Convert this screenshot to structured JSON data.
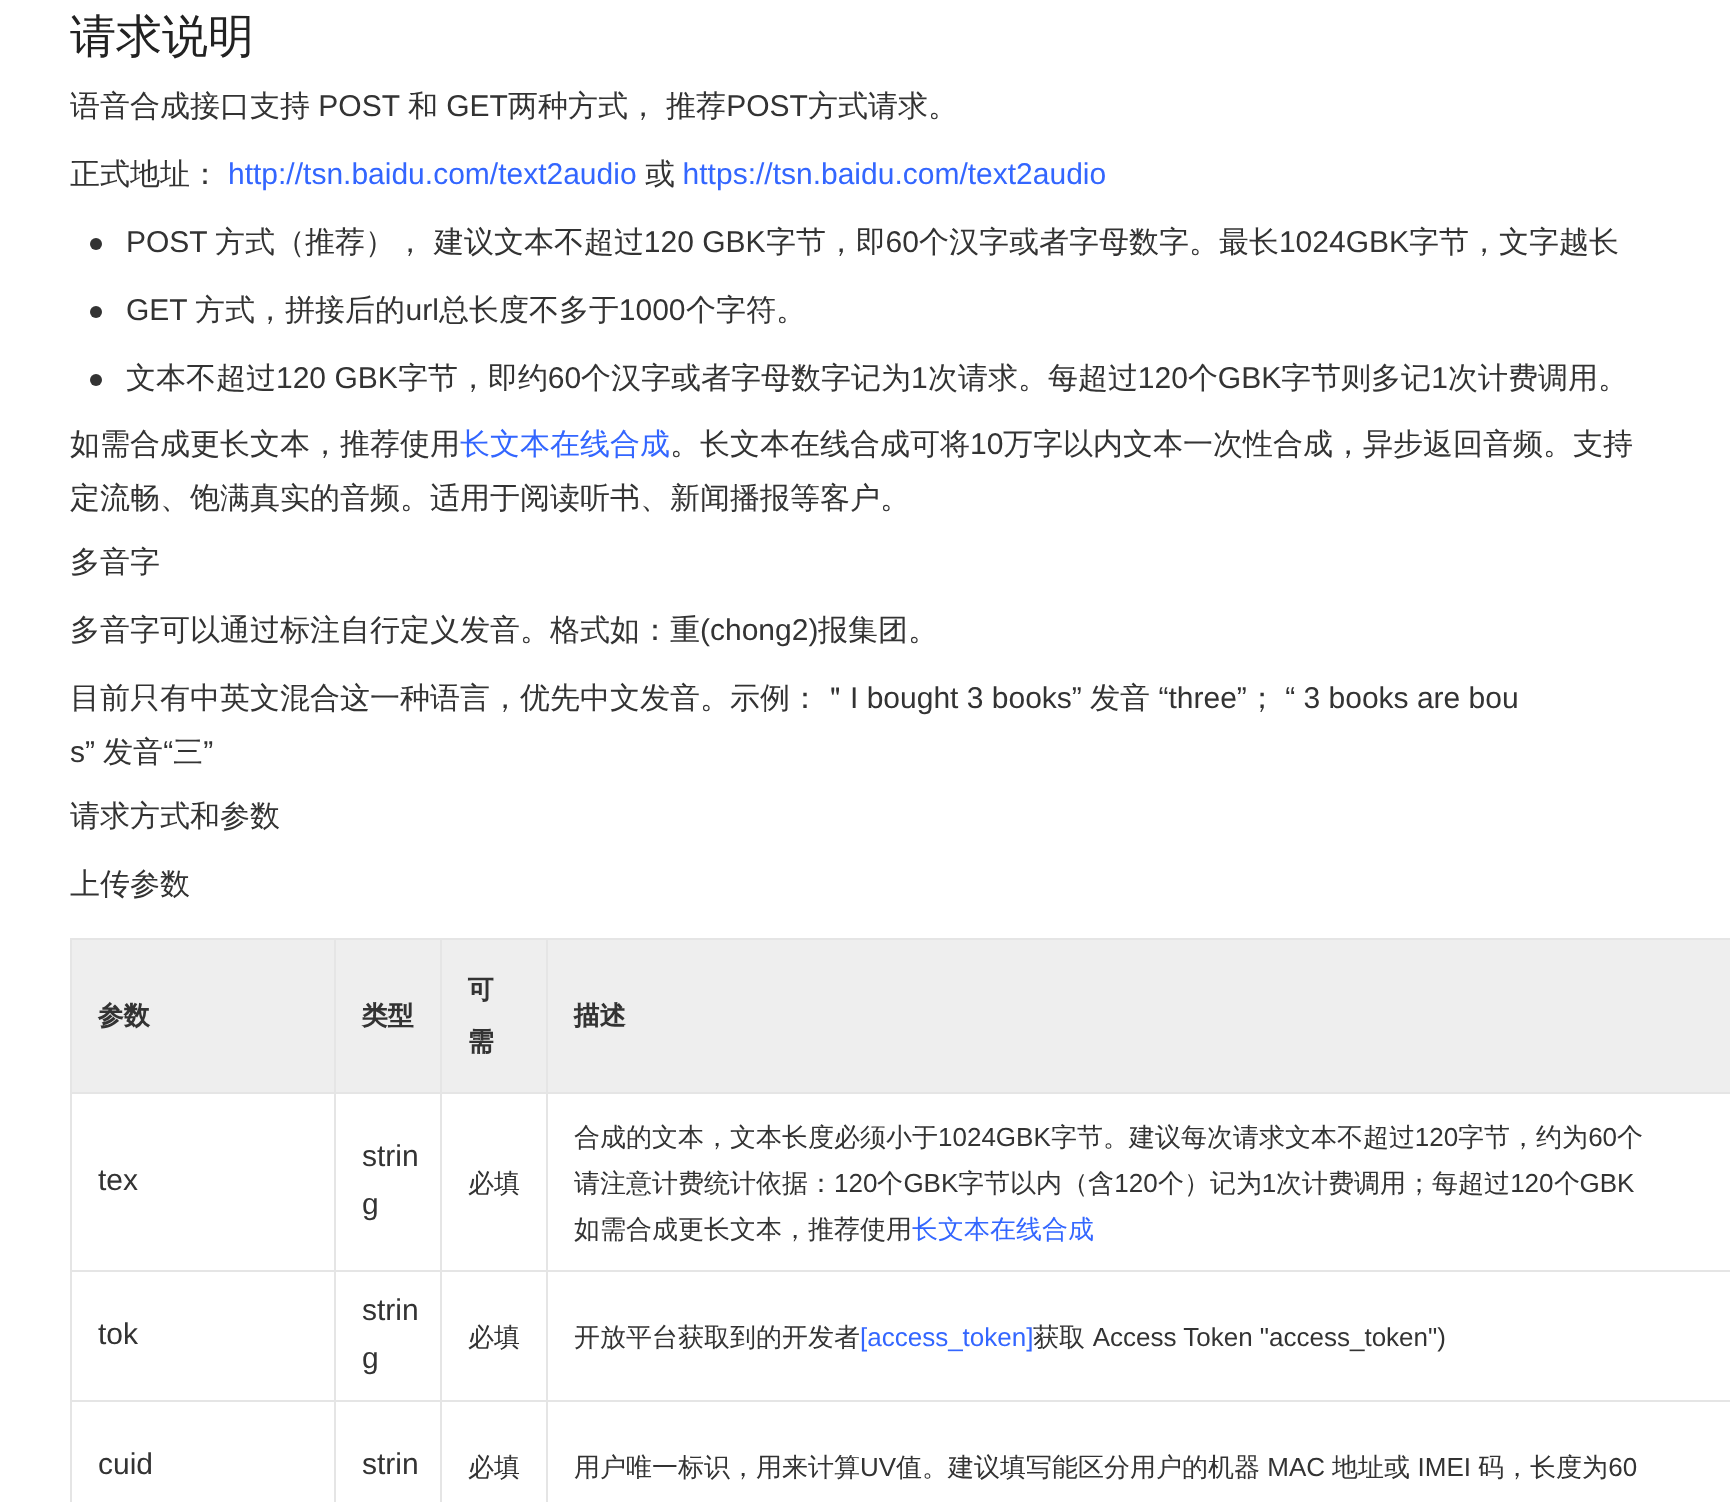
{
  "title": "请求说明",
  "intro": "语音合成接口支持 POST 和 GET两种方式， 推荐POST方式请求。",
  "address": {
    "label": "正式地址：",
    "links": [
      "http://tsn.baidu.com/text2audio",
      "https://tsn.baidu.com/text2audio"
    ],
    "separator": "或"
  },
  "bullets": [
    "POST 方式（推荐）， 建议文本不超过120 GBK字节，即60个汉字或者字母数字。最长1024GBK字节，文字越长",
    "GET 方式，拼接后的url总长度不多于1000个字符。",
    "文本不超过120 GBK字节，即约60个汉字或者字母数字记为1次请求。每超过120个GBK字节则多记1次计费调用。"
  ],
  "long_text": [
    [
      {
        "text": "如需合成更长文本，推荐使用"
      },
      {
        "text": "长文本在线合成",
        "kind": "link"
      },
      {
        "text": "。长文本在线合成可将10万字以内文本一次性合成，异步返回音频。支持"
      }
    ],
    [
      {
        "text": "定流畅、饱满真实的音频。适用于阅读听书、新闻播报等客户。"
      }
    ]
  ],
  "polyphone_heading": "多音字",
  "polyphone_text": "多音字可以通过标注自行定义发音。格式如：重(chong2)报集团。",
  "language_text": [
    "目前只有中英文混合这一种语言，优先中文发音。示例：＂I bought 3 books” 发音 “three”； “ 3 books are bou",
    "s” 发音“三”"
  ],
  "method_heading": "请求方式和参数",
  "upload_heading": "上传参数",
  "table": {
    "columns": [
      "参数",
      "类型",
      "可需",
      "描述"
    ],
    "rows": [
      {
        "param": "tex",
        "type": "string",
        "required": "必填",
        "desc": [
          [
            {
              "text": "合成的文本，文本长度必须小于1024GBK字节。建议每次请求文本不超过120字节，约为60个"
            }
          ],
          [
            {
              "text": "请注意计费统计依据：120个GBK字节以内（含120个）记为1次计费调用；每超过120个GBK"
            }
          ],
          [
            {
              "text": "如需合成更长文本，推荐使用"
            },
            {
              "text": "长文本在线合成",
              "kind": "link"
            }
          ]
        ]
      },
      {
        "param": "tok",
        "type": "string",
        "required": "必填",
        "desc": [
          [
            {
              "text": "开放平台获取到的开发者"
            },
            {
              "text": "[access_token]",
              "kind": "link"
            },
            {
              "text": "获取 Access Token \"access_token\")"
            }
          ]
        ]
      },
      {
        "param": "cuid",
        "type": "strin",
        "required": "必填",
        "desc": [
          [
            {
              "text": "用户唯一标识，用来计算UV值。建议填写能区分用户的机器 MAC 地址或 IMEI 码，长度为60"
            }
          ]
        ]
      }
    ]
  }
}
